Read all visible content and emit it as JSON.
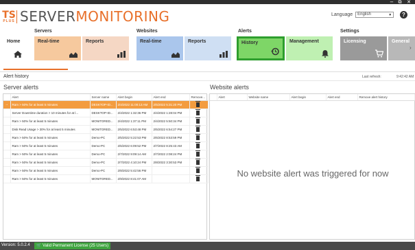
{
  "window": {
    "minimize": "−",
    "restore": "⧉",
    "close": "✕"
  },
  "logo": {
    "ts": "TS",
    "plus": "PLUS",
    "word_a": "SERVER",
    "word_b": "MONITORING"
  },
  "language": {
    "label": "Language",
    "value": "English"
  },
  "groups": {
    "servers": "Servers",
    "websites": "Websites",
    "alerts": "Alerts",
    "settings": "Settings"
  },
  "tiles": {
    "home": "Home",
    "server_realtime": "Real-time",
    "server_reports": "Reports",
    "web_realtime": "Real-time",
    "web_reports": "Reports",
    "history": "History",
    "management": "Management",
    "licensing": "Licensing",
    "general": "General"
  },
  "breadcrumb": "Alert history",
  "refresh": {
    "label": "Last refresh:",
    "time": "9:42:42 AM"
  },
  "server_alerts": {
    "title": "Server alerts",
    "columns": [
      "",
      "Alert",
      "Server name",
      "Alert begin",
      "Alert end",
      "Remove..."
    ],
    "rows": [
      {
        "alert": "Ram > 50% for at least 5 minutes",
        "server": "DESKTOP-ID...",
        "begin": "2/4/2022 11:00:13 AM",
        "end": "2/5/2022 5:31:20 PM"
      },
      {
        "alert": "Server Downtime duration > 10 minutes for at l...",
        "server": "DESKTOP-ID...",
        "begin": "2/4/2022 1:32:36 PM",
        "end": "2/4/2022 1:28:04 PM"
      },
      {
        "alert": "Ram > 50% for at least 5 minutes",
        "server": "MONITORED...",
        "begin": "2/4/2022 1:37:11 PM",
        "end": "2/4/2022 5:50:34 PM"
      },
      {
        "alert": "Disk Read Usage > 30% for at least 5 minutes",
        "server": "MONITORED...",
        "begin": "2/5/2022 6:53:48 PM",
        "end": "2/5/2022 6:54:27 PM"
      },
      {
        "alert": "Ram > 50% for at least 5 minutes",
        "server": "Demo-PC",
        "begin": "2/5/2022 5:22:53 PM",
        "end": "2/6/2022 8:53:59 PM"
      },
      {
        "alert": "Ram > 50% for at least 5 minutes",
        "server": "Demo-PC",
        "begin": "2/6/2022 6:09:52 PM",
        "end": "2/7/2022 8:25:43 AM"
      },
      {
        "alert": "Ram > 50% for at least 5 minutes",
        "server": "Demo-PC",
        "begin": "2/7/2022 9:09:14 AM",
        "end": "2/7/2022 2:08:24 PM"
      },
      {
        "alert": "Ram > 50% for at least 5 minutes",
        "server": "Demo-PC",
        "begin": "2/7/2022 4:10:24 PM",
        "end": "2/8/2022 3:30:53 PM"
      },
      {
        "alert": "Ram > 50% for at least 5 minutes",
        "server": "Demo-PC",
        "begin": "2/8/2022 5:42:56 PM",
        "end": ""
      },
      {
        "alert": "Ram > 50% for at least 5 minutes",
        "server": "MONITORED...",
        "begin": "2/9/2022 8:41:07 AM",
        "end": ""
      }
    ]
  },
  "website_alerts": {
    "title": "Website alerts",
    "columns": [
      "",
      "Alert",
      "Website name",
      "Alert begin",
      "Alert end",
      "Remove alert history"
    ],
    "empty_message": "No website alert was triggered for now"
  },
  "footer": {
    "version": "Version: 5.0.2.4",
    "license": "Valid Permanent License (25 Users)"
  },
  "colors": {
    "brand_orange": "#e8702a",
    "selected_row": "#f39c3f",
    "history_border": "#2e9e2e",
    "license_green": "#3fa43f"
  }
}
